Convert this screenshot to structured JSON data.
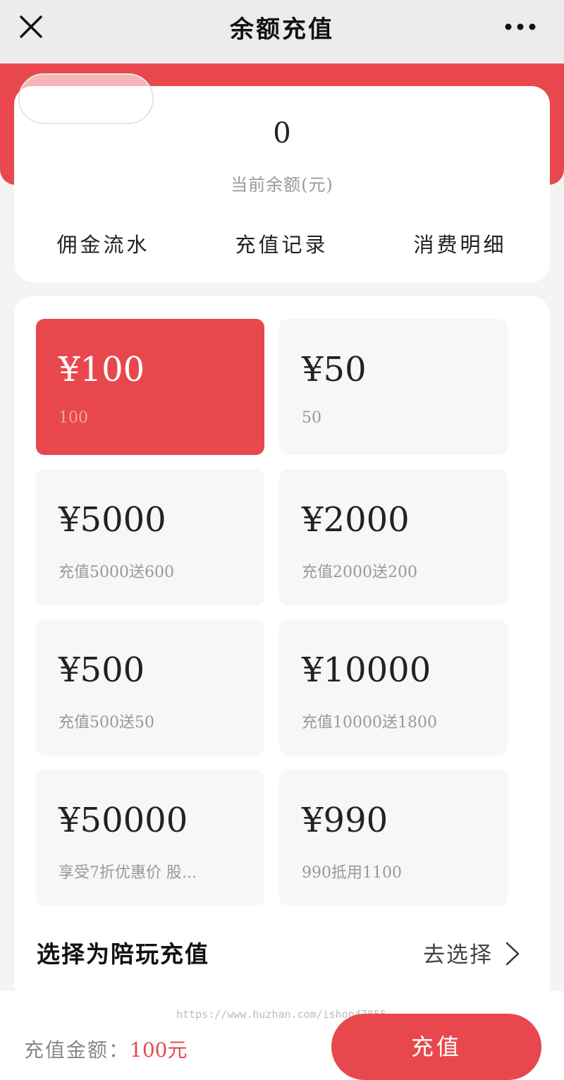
{
  "header": {
    "title": "余额充值",
    "close_icon": "close-icon",
    "more_icon": "more-icon"
  },
  "balance": {
    "value": "0",
    "label": "当前余额(元)",
    "links": [
      "佣金流水",
      "充值记录",
      "消费明细"
    ]
  },
  "options": [
    {
      "price": "¥100",
      "desc": "100",
      "selected": true
    },
    {
      "price": "¥50",
      "desc": "50",
      "selected": false
    },
    {
      "price": "¥5000",
      "desc": "充值5000送600",
      "selected": false
    },
    {
      "price": "¥2000",
      "desc": "充值2000送200",
      "selected": false
    },
    {
      "price": "¥500",
      "desc": "充值500送50",
      "selected": false
    },
    {
      "price": "¥10000",
      "desc": "充值10000送1800",
      "selected": false
    },
    {
      "price": "¥50000",
      "desc": "享受7折优惠价 股...",
      "selected": false
    },
    {
      "price": "¥990",
      "desc": "990抵用1100",
      "selected": false
    }
  ],
  "companion": {
    "title": "选择为陪玩充值",
    "action": "去选择"
  },
  "footer": {
    "watermark": "https://www.huzhan.com/ishop47855",
    "amount_label": "充值金额：",
    "amount_value": "100元",
    "pay_label": "充值"
  },
  "colors": {
    "accent": "#e8484d",
    "background": "#f4f4f4"
  }
}
